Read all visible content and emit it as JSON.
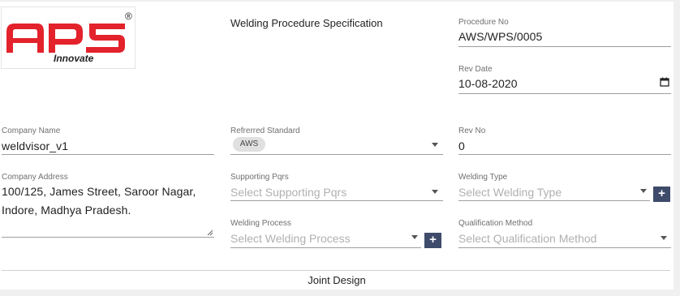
{
  "header": {
    "logo": {
      "text": "aps",
      "tagline": "Innovate",
      "registered": "®"
    },
    "title": "Welding Procedure Specification"
  },
  "fields": {
    "procedure_no": {
      "label": "Procedure No",
      "value": "AWS/WPS/0005"
    },
    "rev_date": {
      "label": "Rev Date",
      "value": "10-08-2020",
      "icon": "calendar-icon"
    },
    "company_name": {
      "label": "Company Name",
      "value": "weldvisor_v1"
    },
    "referred_standard": {
      "label": "Refrerred Standard",
      "chip": "AWS"
    },
    "rev_no": {
      "label": "Rev No",
      "value": "0"
    },
    "company_address": {
      "label": "Company Address",
      "line1": "100/125, James Street, Saroor Nagar,",
      "line2": "Indore, Madhya Pradesh."
    },
    "supporting_pqrs": {
      "label": "Supporting Pqrs",
      "placeholder": "Select Supporting Pqrs"
    },
    "welding_type": {
      "label": "Welding Type",
      "placeholder": "Select Welding Type",
      "add_label": "+"
    },
    "welding_process": {
      "label": "Welding Process",
      "placeholder": "Select Welding Process",
      "add_label": "+"
    },
    "qualification_method": {
      "label": "Qualification Method",
      "placeholder": "Select Qualification Method"
    }
  },
  "section": {
    "joint_design": "Joint Design"
  },
  "colors": {
    "brand_red": "#e3222b",
    "button_navy": "#3f4b6b",
    "chip_bg": "#e0e0e0"
  }
}
